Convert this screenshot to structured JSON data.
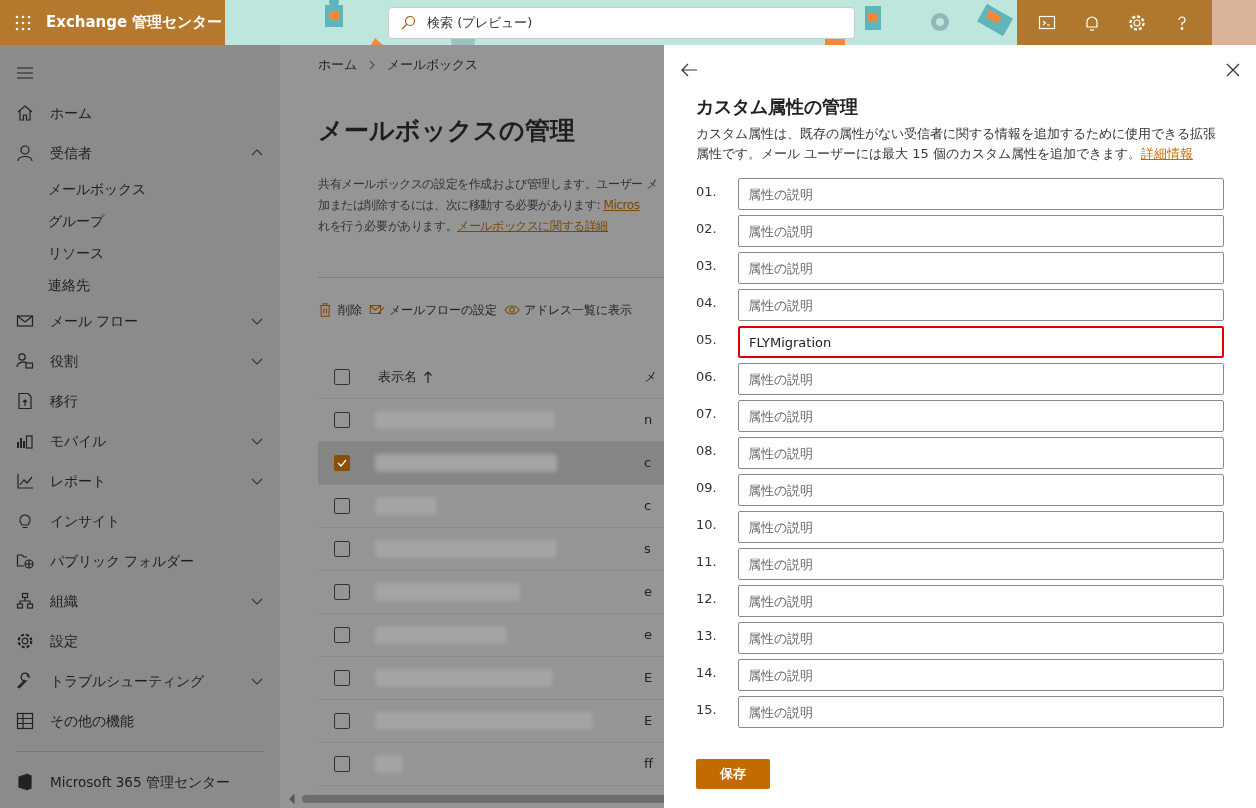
{
  "top_bar": {
    "app_title": "Exchange 管理センター",
    "search": {
      "placeholder": "検索 (プレビュー)"
    }
  },
  "sidebar": {
    "items": [
      {
        "label": "ホーム",
        "kind": "link"
      },
      {
        "label": "受信者",
        "kind": "group",
        "expanded": true,
        "children": [
          {
            "label": "メールボックス"
          },
          {
            "label": "グループ"
          },
          {
            "label": "リソース"
          },
          {
            "label": "連絡先"
          }
        ]
      },
      {
        "label": "メール フロー",
        "kind": "group",
        "expanded": false
      },
      {
        "label": "役割",
        "kind": "group",
        "expanded": false
      },
      {
        "label": "移行",
        "kind": "link"
      },
      {
        "label": "モバイル",
        "kind": "group",
        "expanded": false
      },
      {
        "label": "レポート",
        "kind": "group",
        "expanded": false
      },
      {
        "label": "インサイト",
        "kind": "link"
      },
      {
        "label": "パブリック フォルダー",
        "kind": "link"
      },
      {
        "label": "組織",
        "kind": "group",
        "expanded": false
      },
      {
        "label": "設定",
        "kind": "link"
      },
      {
        "label": "トラブルシューティング",
        "kind": "group",
        "expanded": false
      },
      {
        "label": "その他の機能",
        "kind": "link"
      }
    ],
    "footer": {
      "label": "Microsoft 365 管理センター"
    }
  },
  "main": {
    "breadcrumb": [
      "ホーム",
      "メールボックス"
    ],
    "title": "メールボックスの管理",
    "description": [
      {
        "text": "共有メールボックスの設定を作成および管理します。ユーザー メ"
      },
      {
        "text": "加または削除するには、次に移動する必要があります: ",
        "link": "Micros"
      },
      {
        "text": "れを行う必要があります。",
        "link": "メールボックスに関する詳細"
      }
    ],
    "toolbar": [
      "削除",
      "メールフローの設定",
      "アドレス一覧に表示"
    ],
    "table": {
      "header_selected": false,
      "columns": [
        "表示名",
        "メ"
      ],
      "rows": [
        {
          "selected": false,
          "column_2": "n"
        },
        {
          "selected": true,
          "column_2": "c"
        },
        {
          "selected": false,
          "column_2": "c"
        },
        {
          "selected": false,
          "column_2": "s"
        },
        {
          "selected": false,
          "column_2": "e"
        },
        {
          "selected": false,
          "column_2": "e"
        },
        {
          "selected": false,
          "column_2": "E"
        },
        {
          "selected": false,
          "column_2": "E"
        },
        {
          "selected": false,
          "column_2": "ff"
        }
      ]
    }
  },
  "panel": {
    "title": "カスタム属性の管理",
    "description": "カスタム属性は、既存の属性がない受信者に関する情報を追加するために使用できる拡張属性です。メール ユーザーには最大 15 個のカスタム属性を追加できます。",
    "link": "詳細情報",
    "fields": [
      {
        "label": "01.",
        "placeholder": "属性の説明",
        "highlighted": false
      },
      {
        "label": "02.",
        "placeholder": "属性の説明",
        "highlighted": false
      },
      {
        "label": "03.",
        "placeholder": "属性の説明",
        "highlighted": false
      },
      {
        "label": "04.",
        "placeholder": "属性の説明",
        "highlighted": false
      },
      {
        "label": "05.",
        "value": "FLYMigration",
        "highlighted": true
      },
      {
        "label": "06.",
        "placeholder": "属性の説明",
        "highlighted": false
      },
      {
        "label": "07.",
        "placeholder": "属性の説明",
        "highlighted": false
      },
      {
        "label": "08.",
        "placeholder": "属性の説明",
        "highlighted": false
      },
      {
        "label": "09.",
        "placeholder": "属性の説明",
        "highlighted": false
      },
      {
        "label": "10.",
        "placeholder": "属性の説明",
        "highlighted": false
      },
      {
        "label": "11.",
        "placeholder": "属性の説明",
        "highlighted": false
      },
      {
        "label": "12.",
        "placeholder": "属性の説明",
        "highlighted": false
      },
      {
        "label": "13.",
        "placeholder": "属性の説明",
        "highlighted": false
      },
      {
        "label": "14.",
        "placeholder": "属性の説明",
        "highlighted": false
      },
      {
        "label": "15.",
        "placeholder": "属性の説明",
        "highlighted": false
      }
    ],
    "save_button": "保存"
  }
}
